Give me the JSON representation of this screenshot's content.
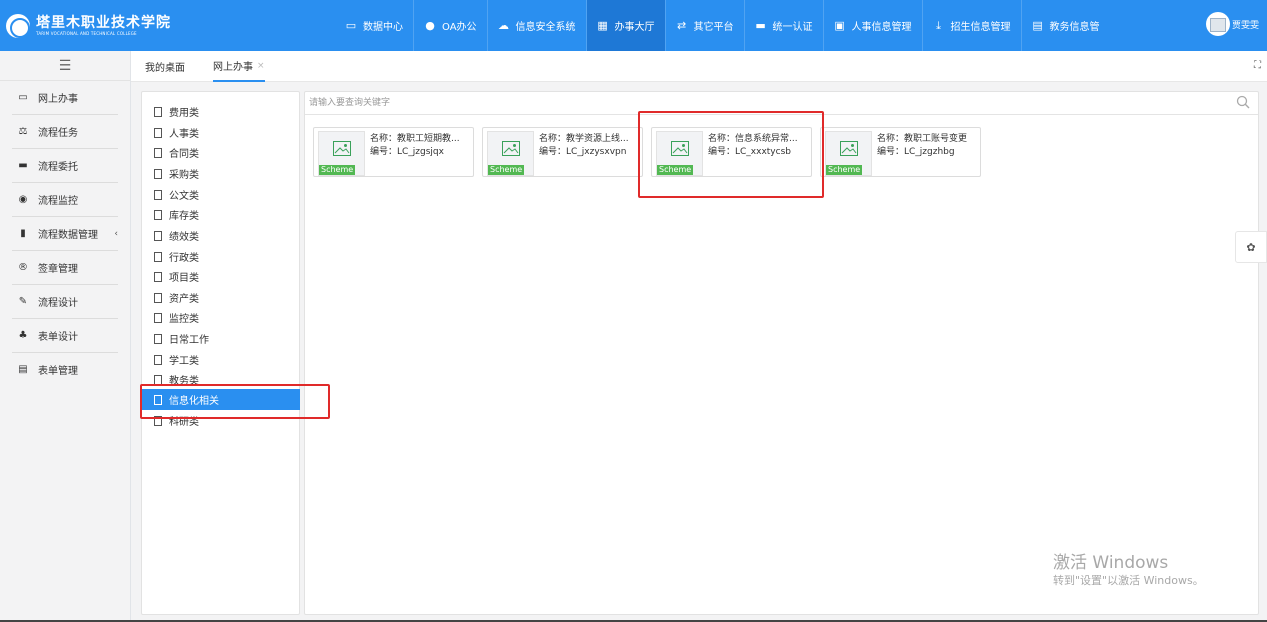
{
  "header": {
    "logo_cn": "塔里木职业技术学院",
    "logo_en": "TARIM VOCATIONAL AND TECHNICAL COLLEGE",
    "nav": [
      {
        "label": "数据中心",
        "icon": "monitor-icon",
        "glyph": "▭"
      },
      {
        "label": "OA办公",
        "icon": "globe-icon",
        "glyph": "●"
      },
      {
        "label": "信息安全系统",
        "icon": "cloud-icon",
        "glyph": "☁"
      },
      {
        "label": "办事大厅",
        "icon": "grid-icon",
        "glyph": "▦"
      },
      {
        "label": "其它平台",
        "icon": "exchange-icon",
        "glyph": "⇄"
      },
      {
        "label": "统一认证",
        "icon": "keyboard-icon",
        "glyph": "▬"
      },
      {
        "label": "人事信息管理",
        "icon": "id-card-icon",
        "glyph": "▣"
      },
      {
        "label": "招生信息管理",
        "icon": "download-icon",
        "glyph": "⤓"
      },
      {
        "label": "教务信息管",
        "icon": "card-icon",
        "glyph": "▤"
      }
    ],
    "active_nav": "办事大厅",
    "user_name": "贾雯雯"
  },
  "sidebar": {
    "toggle_glyph": "☰",
    "items": [
      {
        "label": "网上办事",
        "icon": "window-icon",
        "glyph": "▭"
      },
      {
        "label": "流程任务",
        "icon": "balance-icon",
        "glyph": "⚖"
      },
      {
        "label": "流程委托",
        "icon": "keyboard-icon",
        "glyph": "▬"
      },
      {
        "label": "流程监控",
        "icon": "eye-icon",
        "glyph": "◉"
      },
      {
        "label": "流程数据管理",
        "icon": "book-icon",
        "glyph": "▮",
        "chevron": "‹"
      },
      {
        "label": "签章管理",
        "icon": "registered-icon",
        "glyph": "®"
      },
      {
        "label": "流程设计",
        "icon": "edit-icon",
        "glyph": "✎"
      },
      {
        "label": "表单设计",
        "icon": "sitemap-icon",
        "glyph": "♣"
      },
      {
        "label": "表单管理",
        "icon": "list-icon",
        "glyph": "▤"
      }
    ]
  },
  "tabs": {
    "home": "我的桌面",
    "current": "网上办事",
    "close_glyph": "×",
    "fullscreen_glyph": "⛶"
  },
  "categories": [
    "费用类",
    "人事类",
    "合同类",
    "采购类",
    "公文类",
    "库存类",
    "绩效类",
    "行政类",
    "项目类",
    "资产类",
    "监控类",
    "日常工作",
    "学工类",
    "教务类",
    "信息化相关",
    "科研类"
  ],
  "selected_category": "信息化相关",
  "search": {
    "placeholder": "请输入要查询关键字",
    "value": ""
  },
  "cards": [
    {
      "name": "名称：教职工短期教...",
      "code": "编号：LC_jzgsjqx",
      "badge": "Scheme"
    },
    {
      "name": "名称：教学资源上线...",
      "code": "编号：LC_jxzysxvpn",
      "badge": "Scheme"
    },
    {
      "name": "名称：信息系统异常...",
      "code": "编号：LC_xxxtycsb",
      "badge": "Scheme"
    },
    {
      "name": "名称：教职工账号变更",
      "code": "编号：LC_jzgzhbg",
      "badge": "Scheme"
    }
  ],
  "settings_glyph": "✿",
  "watermark": {
    "title": "激活 Windows",
    "subtitle": "转到\"设置\"以激活 Windows。"
  },
  "colors": {
    "accent": "#2a8ff0",
    "highlight": "#e02a2a",
    "badge": "#52b852"
  }
}
